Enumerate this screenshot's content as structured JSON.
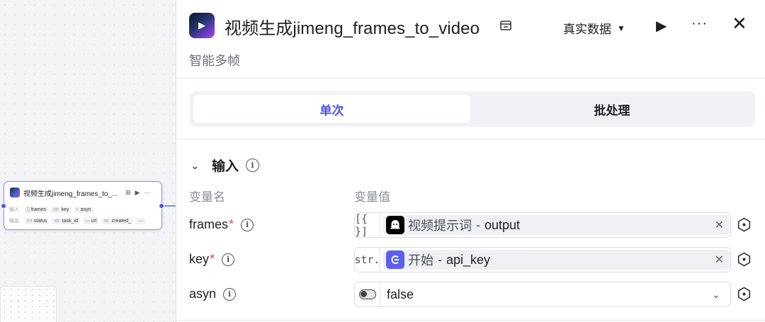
{
  "canvas": {
    "node": {
      "title": "视频生成jimeng_frames_to_...",
      "input_label": "输入",
      "output_label": "输出",
      "inputs": [
        {
          "type": "[]",
          "name": "frames"
        },
        {
          "type": "str.",
          "name": "key"
        },
        {
          "type": "",
          "name": "asyn"
        }
      ],
      "outputs": [
        {
          "type": "Int",
          "name": "status"
        },
        {
          "type": "str.",
          "name": "task_id"
        },
        {
          "type": "",
          "name": "url"
        },
        {
          "type": "str.",
          "name": "created_"
        }
      ],
      "accent": "#4d53e8"
    }
  },
  "panel": {
    "title": "视频生成jimeng_frames_to_video",
    "subtitle": "智能多帧",
    "data_mode": "真实数据",
    "icons": {
      "store": "store-icon",
      "play": "play-icon",
      "more": "more-icon",
      "close": "close-icon"
    },
    "tabs": [
      {
        "label": "单次",
        "active": true
      },
      {
        "label": "批处理",
        "active": false
      }
    ],
    "section": {
      "title": "输入",
      "col_name": "变量名",
      "col_value": "变量值",
      "params": [
        {
          "name": "frames",
          "required": "*",
          "type_glyph": "[{ }]",
          "source_node": "视频提示词",
          "sep": "-",
          "source_var": "output",
          "source_icon": "ghost-icon",
          "source_color": "#000000"
        },
        {
          "name": "key",
          "required": "*",
          "type_glyph": "str.",
          "source_node": "开始",
          "sep": "-",
          "source_var": "api_key",
          "source_icon": "start-icon",
          "source_color": "#5b5ff0"
        },
        {
          "name": "asyn",
          "required": "",
          "value": "false"
        }
      ]
    },
    "accent": "#4d53e8",
    "required_color": "#e5484d"
  }
}
